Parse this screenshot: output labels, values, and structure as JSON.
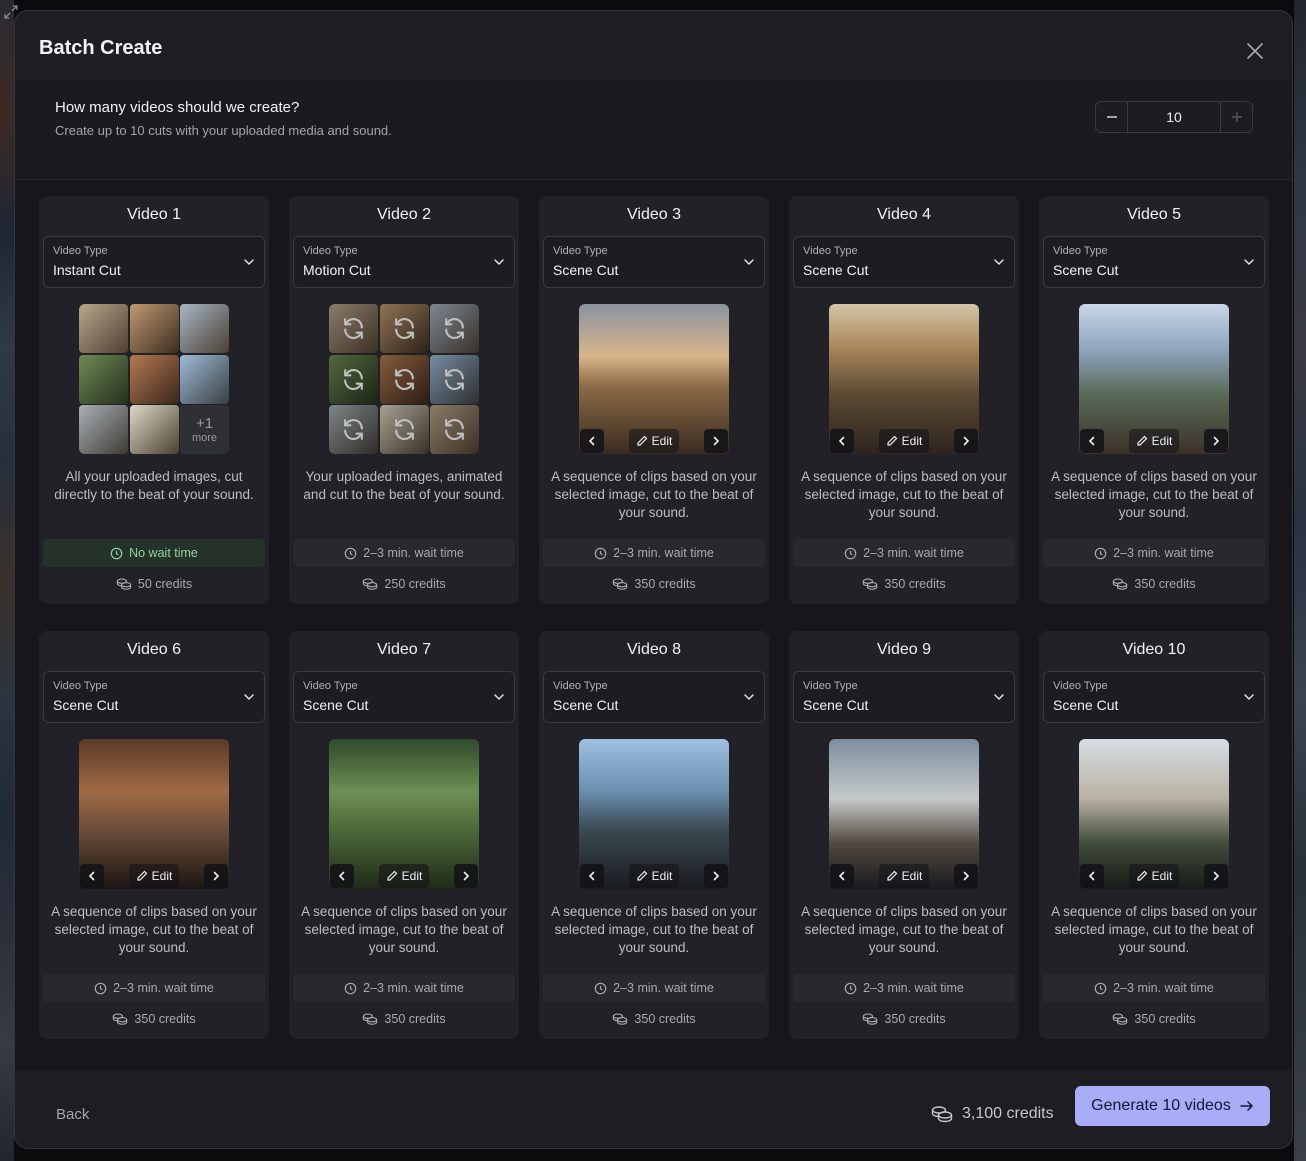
{
  "dialog": {
    "title": "Batch Create",
    "question": "How many videos should we create?",
    "question_sub": "Create up to 10 cuts with your uploaded media and sound.",
    "count_value": "10",
    "close_icon": "close-icon",
    "minus_icon": "minus-icon",
    "plus_icon": "plus-icon"
  },
  "type_label": "Video Type",
  "edit_label": "Edit",
  "more_tile": {
    "count": "+1",
    "label": "more"
  },
  "cards": [
    {
      "title": "Video 1",
      "type": "Instant Cut",
      "desc": "All your uploaded images, cut directly to the beat of your sound.",
      "wait": "No wait time",
      "credits": "50 credits"
    },
    {
      "title": "Video 2",
      "type": "Motion Cut",
      "desc": "Your uploaded images, animated and cut to the beat of your sound.",
      "wait": "2–3 min. wait time",
      "credits": "250 credits"
    },
    {
      "title": "Video 3",
      "type": "Scene Cut",
      "desc": "A sequence of clips based on your selected image, cut to the beat of your sound.",
      "wait": "2–3 min. wait time",
      "credits": "350 credits"
    },
    {
      "title": "Video 4",
      "type": "Scene Cut",
      "desc": "A sequence of clips based on your selected image, cut to the beat of your sound.",
      "wait": "2–3 min. wait time",
      "credits": "350 credits"
    },
    {
      "title": "Video 5",
      "type": "Scene Cut",
      "desc": "A sequence of clips based on your selected image, cut to the beat of your sound.",
      "wait": "2–3 min. wait time",
      "credits": "350 credits"
    },
    {
      "title": "Video 6",
      "type": "Scene Cut",
      "desc": "A sequence of clips based on your selected image, cut to the beat of your sound.",
      "wait": "2–3 min. wait time",
      "credits": "350 credits"
    },
    {
      "title": "Video 7",
      "type": "Scene Cut",
      "desc": "A sequence of clips based on your selected image, cut to the beat of your sound.",
      "wait": "2–3 min. wait time",
      "credits": "350 credits"
    },
    {
      "title": "Video 8",
      "type": "Scene Cut",
      "desc": "A sequence of clips based on your selected image, cut to the beat of your sound.",
      "wait": "2–3 min. wait time",
      "credits": "350 credits"
    },
    {
      "title": "Video 9",
      "type": "Scene Cut",
      "desc": "A sequence of clips based on your selected image, cut to the beat of your sound.",
      "wait": "2–3 min. wait time",
      "credits": "350 credits"
    },
    {
      "title": "Video 10",
      "type": "Scene Cut",
      "desc": "A sequence of clips based on your selected image, cut to the beat of your sound.",
      "wait": "2–3 min. wait time",
      "credits": "350 credits"
    }
  ],
  "footer": {
    "back_label": "Back",
    "total_credits": "3,100 credits",
    "generate_label": "Generate 10 videos"
  },
  "colors": {
    "accent": "#a9adf7",
    "no_wait_green": "#8fd3a0",
    "surface": "#1d1d22",
    "card": "#212127"
  }
}
